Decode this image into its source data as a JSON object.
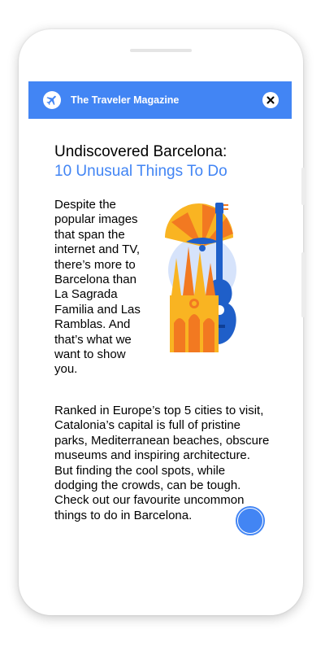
{
  "app": {
    "title": "The Traveler Magazine"
  },
  "article": {
    "title_line1": "Undiscovered Barcelona:",
    "title_line2": "10 Unusual Things To Do",
    "intro": "Despite the popular images that span the internet and TV, there’s more to Barcelona than La Sagrada Familia and Las Ramblas. And that’s what we want to show you.",
    "body_line1": "Ranked in Europe’s top 5 cities to visit, Catalonia’s capital is full of pristine parks, Mediterranean beaches, obscure museums and inspiring architecture. But finding the cool spots, while dodging the crowds, can be tough.",
    "body_line2": "Check out our favourite uncommon things to do in Barcelona."
  },
  "icons": {
    "logo": "airplane-icon",
    "close": "close-icon",
    "illustration": "fan-cathedral-guitar-illustration"
  },
  "colors": {
    "brand_blue": "#4285f4",
    "guitar_blue": "#1f5fc9",
    "fan_yellow": "#f9b422",
    "fan_orange": "#f27921",
    "light_blue_circle": "#d6e3fb"
  }
}
